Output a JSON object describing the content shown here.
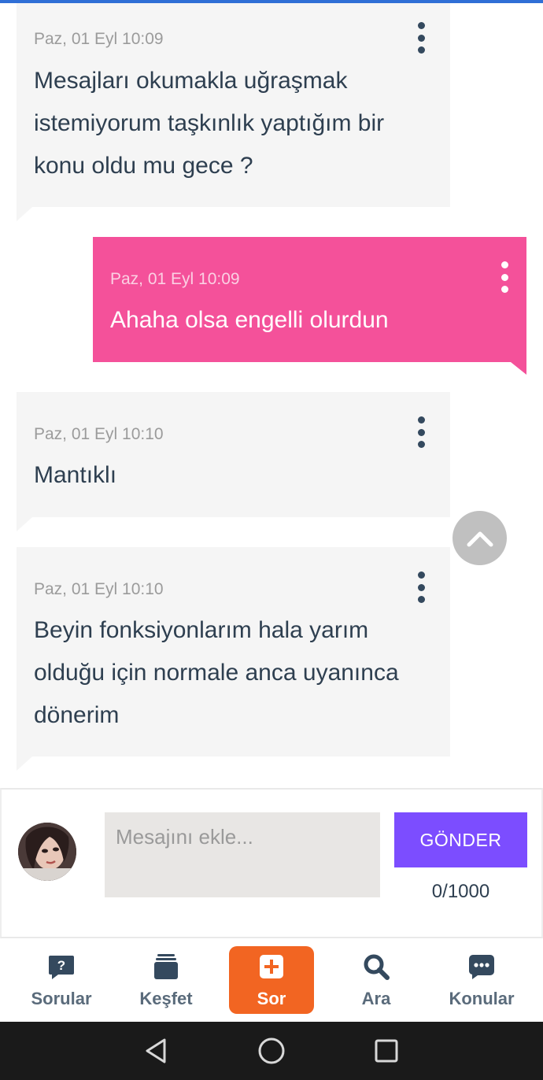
{
  "accent": "#2f6fd6",
  "messages": [
    {
      "direction": "incoming",
      "timestamp": "Paz, 01 Eyl 10:09",
      "text": "Mesajları okumakla uğraşmak istemiyorum taşkınlık yaptığım bir konu oldu mu gece ?",
      "bubble_color": "#f5f5f5"
    },
    {
      "direction": "outgoing",
      "timestamp": "Paz, 01 Eyl 10:09",
      "text": "Ahaha olsa engelli olurdun",
      "bubble_color": "#f4519a"
    },
    {
      "direction": "incoming",
      "timestamp": "Paz, 01 Eyl 10:10",
      "text": "Mantıklı",
      "bubble_color": "#f5f5f5"
    },
    {
      "direction": "incoming",
      "timestamp": "Paz, 01 Eyl 10:10",
      "text": "Beyin fonksiyonlarım hala yarım olduğu için normale anca uyanınca dönerim",
      "bubble_color": "#f5f5f5"
    }
  ],
  "composer": {
    "placeholder": "Mesajını ekle...",
    "value": "",
    "send_label": "GÖNDER",
    "send_color": "#7c4dff",
    "counter": "0/1000"
  },
  "nav": {
    "items": [
      {
        "label": "Sorular",
        "icon": "question-bubble-icon"
      },
      {
        "label": "Keşfet",
        "icon": "stack-icon"
      },
      {
        "label": "Sor",
        "icon": "plus-square-icon",
        "active": true,
        "color": "#f26522"
      },
      {
        "label": "Ara",
        "icon": "search-icon"
      },
      {
        "label": "Konular",
        "icon": "chat-dots-icon"
      }
    ]
  },
  "system_nav": {
    "icons": [
      "back-icon",
      "home-icon",
      "recents-icon"
    ]
  }
}
